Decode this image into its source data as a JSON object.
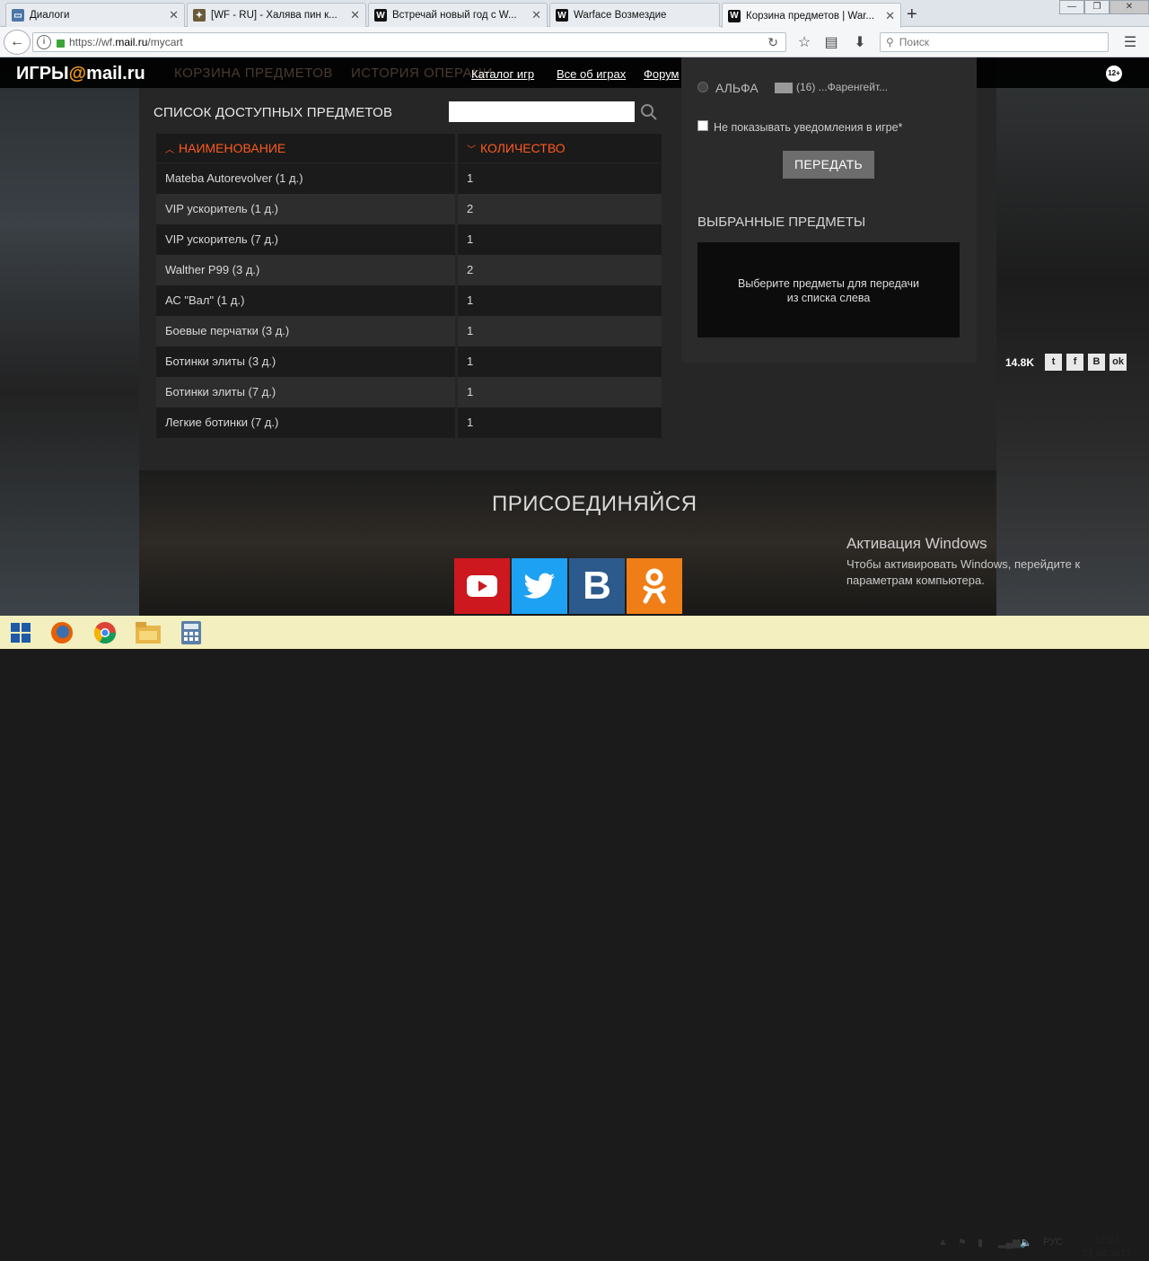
{
  "browser": {
    "tabs": [
      {
        "title": "Диалоги"
      },
      {
        "title": "[WF - RU] - Халява пин к..."
      },
      {
        "title": "Встречай новый год с W..."
      },
      {
        "title": "Warface Возмездие"
      },
      {
        "title": "Корзина предметов | War..."
      }
    ],
    "url_prefix": "https://wf.",
    "url_domain": "mail.ru",
    "url_path": "/mycart",
    "search_placeholder": "Поиск"
  },
  "site": {
    "logo_a": "ИГРЫ",
    "logo_b": "@",
    "logo_c": "mail.ru",
    "ghost_nav_1": "КОРЗИНА ПРЕДМЕТОВ",
    "ghost_nav_2": "ИСТОРИЯ ОПЕРАЦИ",
    "links": [
      "Каталог игр",
      "Все об играх",
      "Форум"
    ],
    "age": "12+"
  },
  "list": {
    "title": "СПИСОК ДОСТУПНЫХ ПРЕДМЕТОВ",
    "col_name": "НАИМЕНОВАНИЕ",
    "col_qty": "КОЛИЧЕСТВО",
    "rows": [
      {
        "name": "Mateba Autorevolver (1 д.)",
        "qty": "1"
      },
      {
        "name": "VIP ускоритель (1 д.)",
        "qty": "2"
      },
      {
        "name": "VIP ускоритель (7 д.)",
        "qty": "1"
      },
      {
        "name": "Walther P99 (3 д.)",
        "qty": "2"
      },
      {
        "name": "АС \"Вал\" (1 д.)",
        "qty": "1"
      },
      {
        "name": "Боевые перчатки (3 д.)",
        "qty": "1"
      },
      {
        "name": "Ботинки элиты (3 д.)",
        "qty": "1"
      },
      {
        "name": "Ботинки элиты (7 д.)",
        "qty": "1"
      },
      {
        "name": "Легкие ботинки (7 д.)",
        "qty": "1"
      }
    ]
  },
  "transfer": {
    "server": "АЛЬФА",
    "player": "(16) ...Фаренгейт...",
    "no_notify": "Не показывать уведомления в игре*",
    "send": "ПЕРЕДАТЬ",
    "selected_title": "ВЫБРАННЫЕ ПРЕДМЕТЫ",
    "selected_empty_1": "Выберите предметы для передачи",
    "selected_empty_2": "из списка слева"
  },
  "share": {
    "count": "14.8K",
    "icons": [
      "twitter-icon",
      "facebook-icon",
      "vk-icon",
      "odnoklassniki-icon"
    ]
  },
  "join": {
    "title": "ПРИСОЕДИНЯЙСЯ"
  },
  "activation": {
    "title": "Активация Windows",
    "line1": "Чтобы активировать Windows, перейдите к",
    "line2": "параметрам компьютера."
  },
  "taskbar": {
    "lang": "РУС",
    "time": "12:24",
    "date": "21.03.2017"
  },
  "colors": {
    "accent": "#ff5a1e",
    "youtube": "#cc181e",
    "twitter": "#1da1f2",
    "vk": "#2d5a8c",
    "ok": "#f07e16"
  }
}
